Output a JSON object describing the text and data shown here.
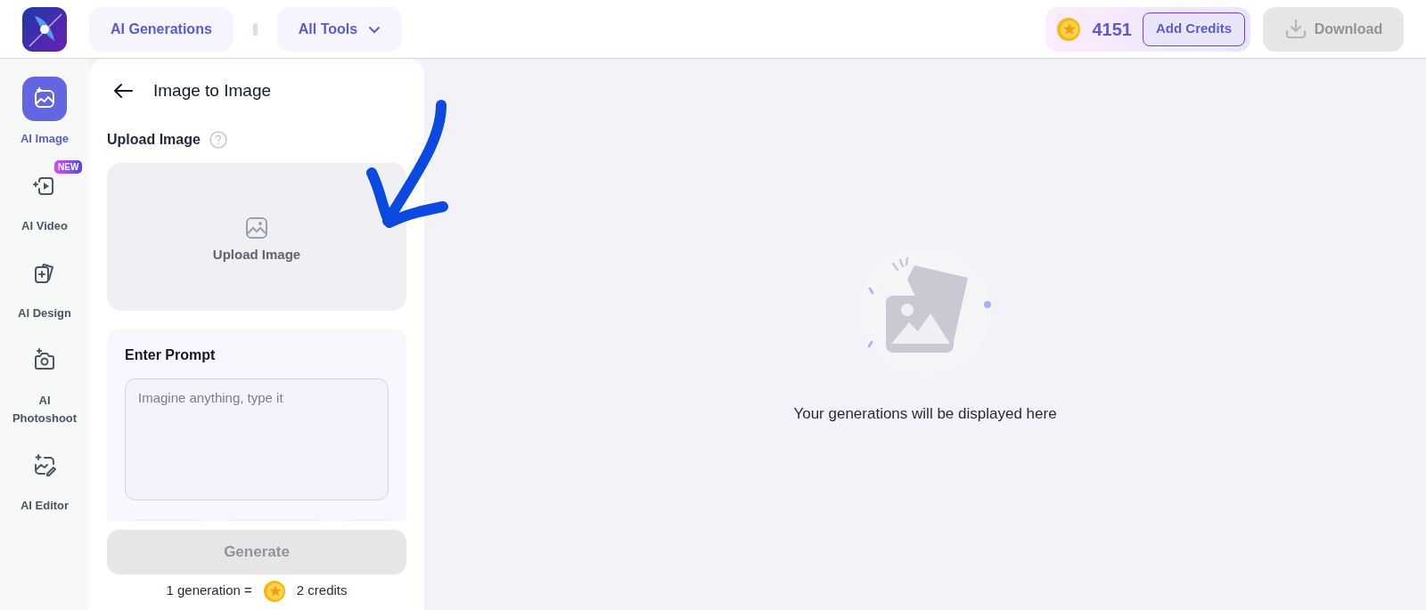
{
  "topbar": {
    "nav": [
      {
        "label": "AI Generations",
        "kind": "button"
      },
      {
        "label": "All Tools",
        "kind": "dropdown"
      }
    ],
    "credits": {
      "amount": "4151",
      "add_label": "Add Credits"
    },
    "download": {
      "label": "Download",
      "disabled": true
    }
  },
  "sidebar": {
    "items": [
      {
        "label": "AI Image",
        "kind": "image",
        "selected": true
      },
      {
        "label": "AI Video",
        "kind": "video",
        "selected": false,
        "badge": "NEW"
      },
      {
        "label": "AI Design",
        "kind": "design",
        "selected": false
      },
      {
        "label": "AI Photoshoot",
        "kind": "camera",
        "selected": false
      },
      {
        "label": "AI Editor",
        "kind": "editor",
        "selected": false
      }
    ]
  },
  "panel": {
    "title": "Image to Image",
    "upload": {
      "label": "Upload Image",
      "drop_label": "Upload Image"
    },
    "prompt": {
      "label": "Enter Prompt",
      "placeholder": "Imagine anything, type it"
    },
    "generate": {
      "label": "Generate",
      "disabled": true
    },
    "cost": {
      "left": "1 generation =",
      "right": "2 credits"
    }
  },
  "main": {
    "empty_message": "Your generations will be displayed here"
  }
}
